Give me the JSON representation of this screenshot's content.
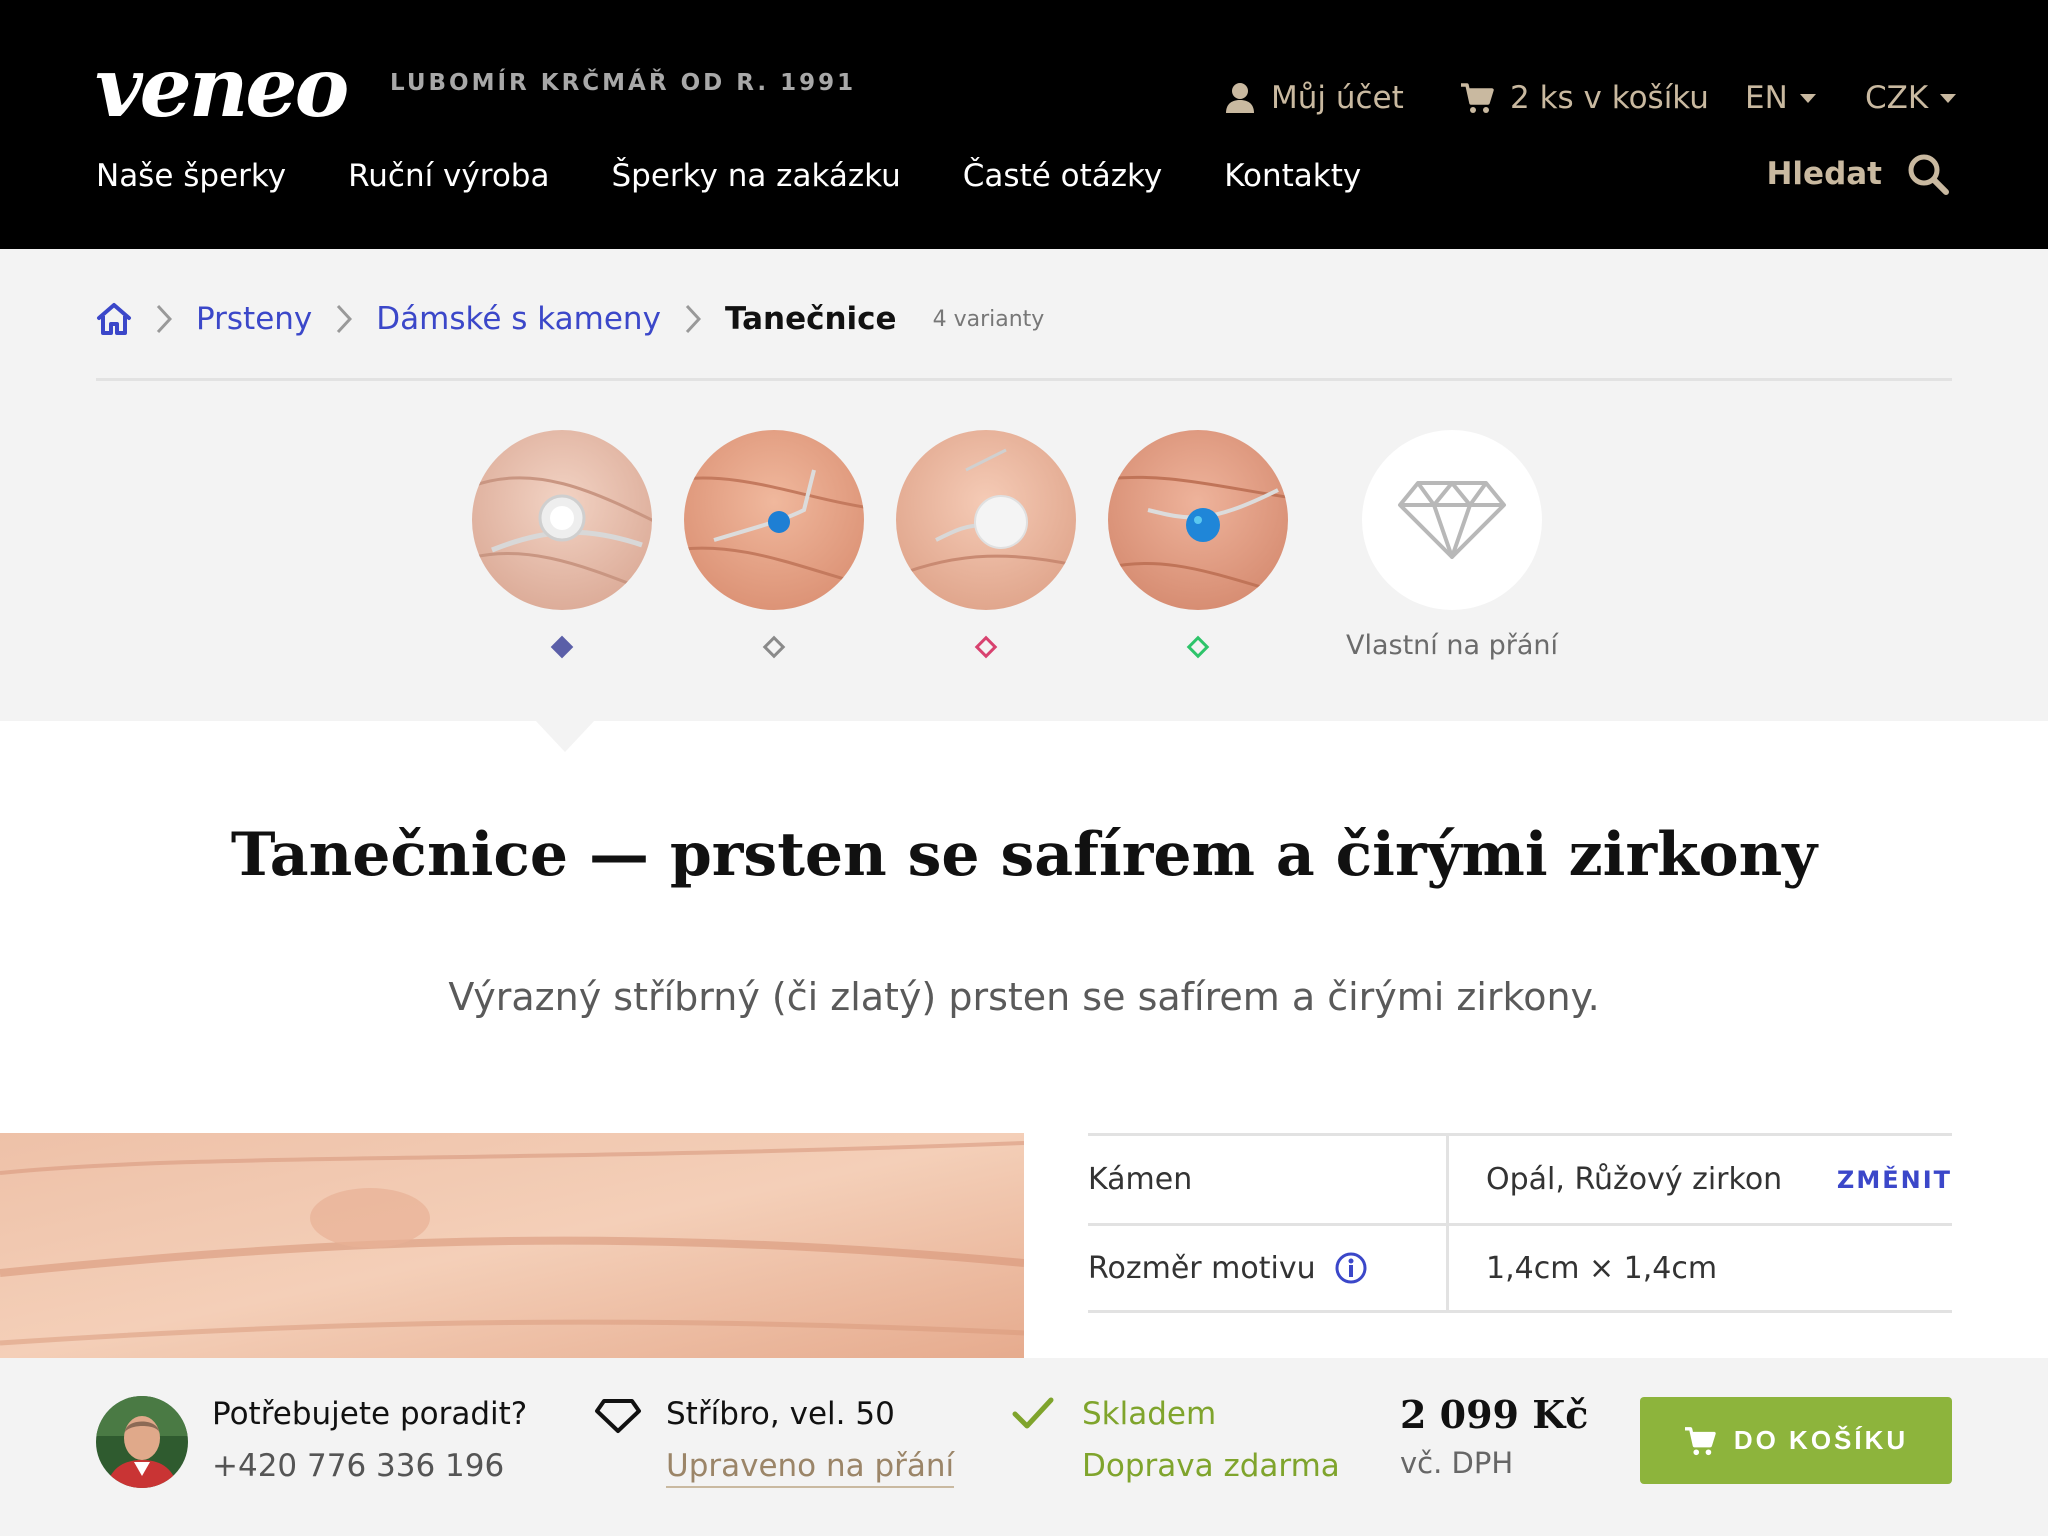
{
  "header": {
    "logo": "veneo",
    "tagline": "LUBOMÍR KRČMÁŘ OD R. 1991",
    "account": "Můj účet",
    "cart": "2 ks v košíku",
    "language": "EN",
    "currency": "CZK",
    "nav": [
      "Naše šperky",
      "Ruční výroba",
      "Šperky na zakázku",
      "Časté otázky",
      "Kontakty"
    ],
    "search": "Hledat"
  },
  "breadcrumb": {
    "items": [
      "Prsteny",
      "Dámské s kameny"
    ],
    "current": "Tanečnice",
    "variants": "4 varianty"
  },
  "variants": {
    "dot_colors": [
      "#5b5fa8",
      "#8a8a8a",
      "#d8426f",
      "#2ec46a"
    ],
    "custom_label": "Vlastní na přání"
  },
  "product": {
    "title": "Tanečnice — prsten se safírem a čirými zirkony",
    "subtitle": "Výrazný stříbrný (či zlatý) prsten se safírem a čirými zirkony."
  },
  "spec": {
    "rows": [
      {
        "label": "Kámen",
        "value": "Opál, Růžový zirkon",
        "action": "ZMĚNIT"
      },
      {
        "label": "Rozměr motivu",
        "value": "1,4cm × 1,4cm"
      }
    ]
  },
  "bottom_bar": {
    "help_question": "Potřebujete poradit?",
    "phone": "+420 776 336 196",
    "variant": "Stříbro, vel. 50",
    "custom": "Upraveno na přání",
    "stock": "Skladem",
    "shipping": "Doprava zdarma",
    "price": "2 099 Kč",
    "vat": "vč. DPH",
    "buy_label": "DO KOŠÍKU"
  },
  "colors": {
    "accent": "#3b47c9",
    "gold": "#c9b9a0",
    "green": "#8db43c"
  }
}
